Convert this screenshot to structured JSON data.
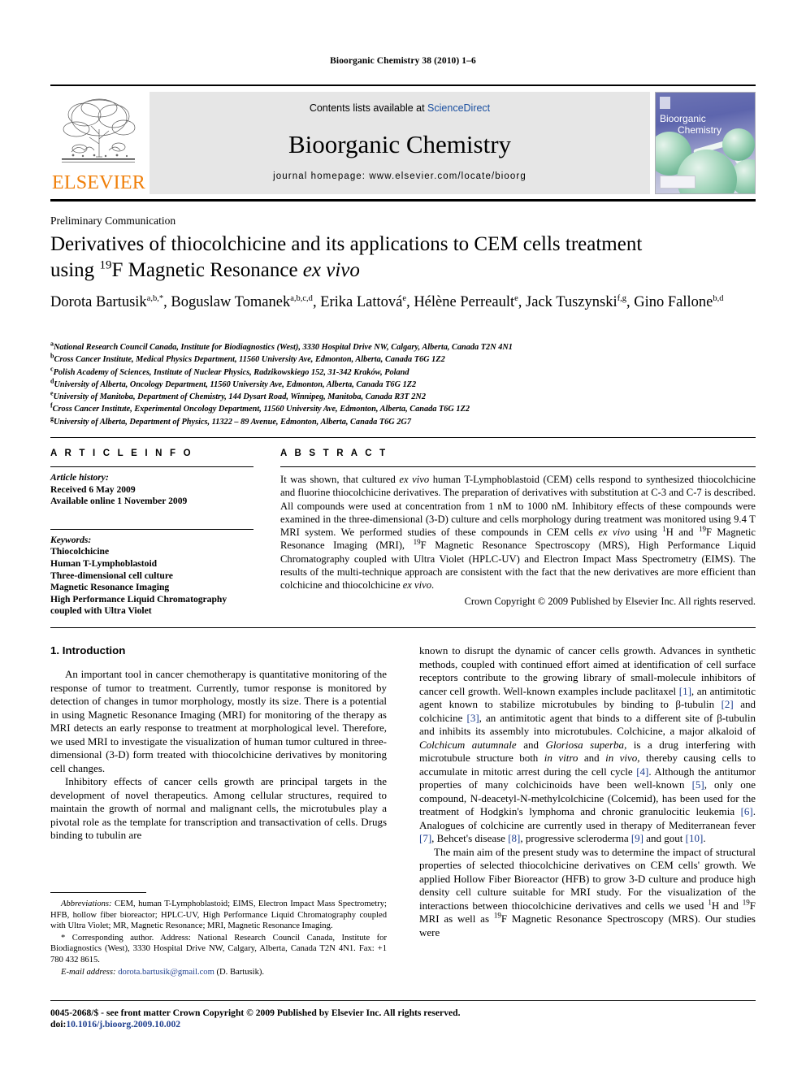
{
  "running_head": "Bioorganic Chemistry 38 (2010) 1–6",
  "masthead": {
    "contents_prefix": "Contents lists available at ",
    "sciencedirect": "ScienceDirect",
    "journal_name": "Bioorganic Chemistry",
    "homepage": "journal homepage: www.elsevier.com/locate/bioorg",
    "publisher_wordmark": "ELSEVIER",
    "cover_title_line1": "Bioorganic",
    "cover_title_line2": "Chemistry",
    "accent_orange": "#F07F09",
    "link_blue": "#1a4fa0",
    "band_gray": "#e6e6e6"
  },
  "article": {
    "type": "Preliminary Communication",
    "title_line1": "Derivatives of thiocolchicine and its applications to CEM cells treatment",
    "title_line2_pre": "using ",
    "title_sup": "19",
    "title_line2_mid": "F Magnetic Resonance ",
    "title_italic": "ex vivo",
    "authors": [
      {
        "name": "Dorota Bartusik",
        "marks": "a,b,*",
        "sep": ", "
      },
      {
        "name": "Boguslaw Tomanek",
        "marks": "a,b,c,d",
        "sep": ", "
      },
      {
        "name": "Erika Lattová",
        "marks": "e",
        "sep": ", "
      },
      {
        "name": "Hélène Perreault",
        "marks": "e",
        "sep": ", "
      },
      {
        "name": "Jack Tuszynski",
        "marks": "f,g",
        "sep": ", "
      },
      {
        "name": "Gino Fallone",
        "marks": "b,d",
        "sep": ""
      }
    ],
    "affiliations": [
      {
        "mark": "a",
        "text": "National Research Council Canada, Institute for Biodiagnostics (West), 3330 Hospital Drive NW, Calgary, Alberta, Canada T2N 4N1"
      },
      {
        "mark": "b",
        "text": "Cross Cancer Institute, Medical Physics Department, 11560 University Ave, Edmonton, Alberta, Canada T6G 1Z2"
      },
      {
        "mark": "c",
        "text": "Polish Academy of Sciences, Institute of Nuclear Physics, Radzikowskiego 152, 31-342 Kraków, Poland"
      },
      {
        "mark": "d",
        "text": "University of Alberta, Oncology Department, 11560 University Ave, Edmonton, Alberta, Canada T6G 1Z2"
      },
      {
        "mark": "e",
        "text": "University of Manitoba, Department of Chemistry, 144 Dysart Road, Winnipeg, Manitoba, Canada R3T 2N2"
      },
      {
        "mark": "f",
        "text": "Cross Cancer Institute, Experimental Oncology Department, 11560 University Ave, Edmonton, Alberta, Canada T6G 1Z2"
      },
      {
        "mark": "g",
        "text": "University of Alberta, Department of Physics, 11322 – 89 Avenue, Edmonton, Alberta, Canada T6G 2G7"
      }
    ]
  },
  "article_info": {
    "heading": "A R T I C L E    I N F O",
    "history_label": "Article history:",
    "history": [
      "Received 6 May 2009",
      "Available online 1 November 2009"
    ],
    "keywords_label": "Keywords:",
    "keywords": [
      "Thiocolchicine",
      "Human T-Lymphoblastoid",
      "Three-dimensional cell culture",
      "Magnetic Resonance Imaging",
      "High Performance Liquid Chromatography",
      "coupled with Ultra Violet"
    ]
  },
  "abstract": {
    "heading": "A B S T R A C T",
    "copyright": "Crown Copyright © 2009 Published by Elsevier Inc. All rights reserved."
  },
  "body": {
    "section1_heading": "1. Introduction",
    "footnotes": {
      "abbrev_label": "Abbreviations:",
      "abbrev_text": " CEM, human T-Lymphoblastoid; EIMS, Electron Impact Mass Spectrometry; HFB, hollow fiber bioreactor; HPLC-UV, High Performance Liquid Chromatography coupled with Ultra Violet; MR, Magnetic Resonance; MRI, Magnetic Resonance Imaging.",
      "corresponding": "* Corresponding author. Address: National Research Council Canada, Institute for Biodiagnostics (West), 3330 Hospital Drive NW, Calgary, Alberta, Canada T2N 4N1. Fax: +1 780 432 8615.",
      "email_label": "E-mail address:",
      "email": "dorota.bartusik@gmail.com",
      "email_suffix": " (D. Bartusik)."
    }
  },
  "footer": {
    "issn_line": "0045-2068/$ - see front matter Crown Copyright © 2009 Published by Elsevier Inc. All rights reserved.",
    "doi_label": "doi:",
    "doi": "10.1016/j.bioorg.2009.10.002"
  }
}
